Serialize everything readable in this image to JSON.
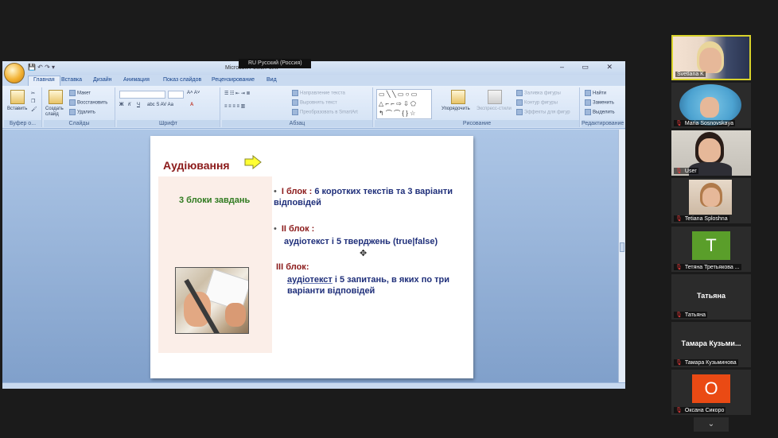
{
  "language_indicator": "RU Русский (Россия)",
  "window": {
    "title": "Microsoft PowerPoint",
    "controls": "– ▭ ✕"
  },
  "ribbon_tabs": [
    "Главная",
    "Вставка",
    "Дизайн",
    "Анимация",
    "Показ слайдов",
    "Рецензирование",
    "Вид"
  ],
  "ribbon_groups": {
    "clipboard": {
      "title": "Буфер о...",
      "paste": "Вставить"
    },
    "slides": {
      "title": "Слайды",
      "create": "Создать слайд",
      "layout": "Макет",
      "reset": "Восстановить",
      "delete": "Удалить"
    },
    "font": {
      "title": "Шрифт"
    },
    "paragraph": {
      "title": "Абзац",
      "text_direction": "Направление текста",
      "align_text": "Выровнять текст",
      "smartart": "Преобразовать в SmartArt"
    },
    "drawing": {
      "title": "Рисование",
      "arrange": "Упорядочить",
      "quick_styles": "Экспресс-стили",
      "fill": "Заливка фигуры",
      "outline": "Контур фигуры",
      "effects": "Эффекты для фигур"
    },
    "editing": {
      "title": "Редактирование",
      "find": "Найти",
      "replace": "Заменить",
      "select": "Выделить"
    }
  },
  "slide": {
    "title": "Аудіювання",
    "left_label": "3 блоки завдань",
    "block1_name": "І блок :",
    "block1_text": "6 коротких текстів та 3 варіанти відповідей",
    "block2_name": "ІІ  блок :",
    "block2_text": "аудіотекст і 5 тверджень (true|false)",
    "block3_name": "ІІІ блок:",
    "block3_text_a": "аудіотекст",
    "block3_text_b": "  і 5 запитань, в яких по три варіанти відповідей"
  },
  "participants": [
    {
      "name": "Svetlana K",
      "muted": false,
      "type": "video"
    },
    {
      "name": "Maria Sosnovskaya",
      "muted": true,
      "type": "video"
    },
    {
      "name": "User",
      "muted": true,
      "type": "video"
    },
    {
      "name": "Tetiana Sploshna",
      "muted": true,
      "type": "video"
    },
    {
      "name": "Тетяна Третьякова ...",
      "muted": true,
      "type": "letter",
      "letter": "T",
      "color": "#5a9e2a"
    },
    {
      "name": "Татьяна",
      "muted": true,
      "type": "name",
      "center": "Татьяна"
    },
    {
      "name": "Тамара Кузьминова",
      "muted": true,
      "type": "name",
      "center": "Тамара  Кузьми..."
    },
    {
      "name": "Оксана Сикоро",
      "muted": true,
      "type": "letter",
      "letter": "O",
      "color": "#ea4a14"
    }
  ],
  "more_label": "⌄"
}
